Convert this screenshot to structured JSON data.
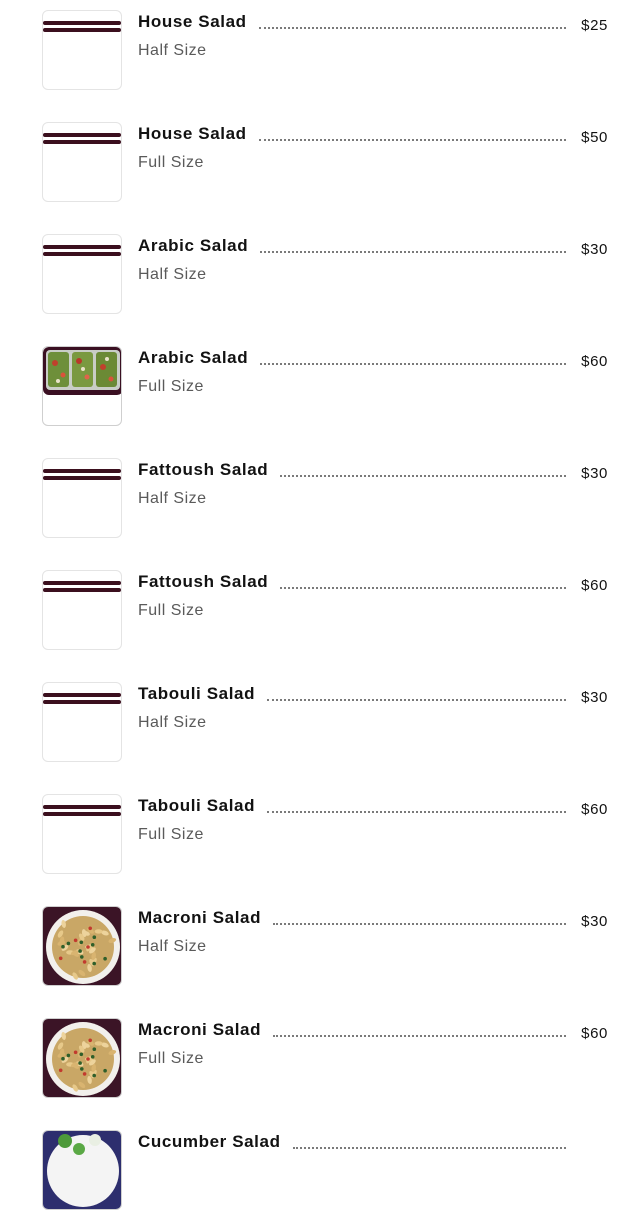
{
  "menu": {
    "items": [
      {
        "name": "House Salad",
        "size": "Half Size",
        "price": "$25",
        "image": "placeholder"
      },
      {
        "name": "House Salad",
        "size": "Full Size",
        "price": "$50",
        "image": "placeholder"
      },
      {
        "name": "Arabic Salad",
        "size": "Half Size",
        "price": "$30",
        "image": "placeholder"
      },
      {
        "name": "Arabic Salad",
        "size": "Full Size",
        "price": "$60",
        "image": "arabic-salad-photo"
      },
      {
        "name": "Fattoush Salad",
        "size": "Half Size",
        "price": "$30",
        "image": "placeholder"
      },
      {
        "name": "Fattoush Salad",
        "size": "Full Size",
        "price": "$60",
        "image": "placeholder"
      },
      {
        "name": "Tabouli Salad",
        "size": "Half Size",
        "price": "$30",
        "image": "placeholder"
      },
      {
        "name": "Tabouli Salad",
        "size": "Full Size",
        "price": "$60",
        "image": "placeholder"
      },
      {
        "name": "Macroni Salad",
        "size": "Half Size",
        "price": "$30",
        "image": "macaroni-salad-photo"
      },
      {
        "name": "Macroni Salad",
        "size": "Full Size",
        "price": "$60",
        "image": "macaroni-salad-photo"
      },
      {
        "name": "Cucumber Salad",
        "size": "",
        "price": "",
        "image": "cucumber-salad-photo"
      }
    ]
  },
  "colors": {
    "placeholder_bar": "#3b0f1e",
    "text_primary": "#121212",
    "text_secondary": "#5a5a5a"
  }
}
